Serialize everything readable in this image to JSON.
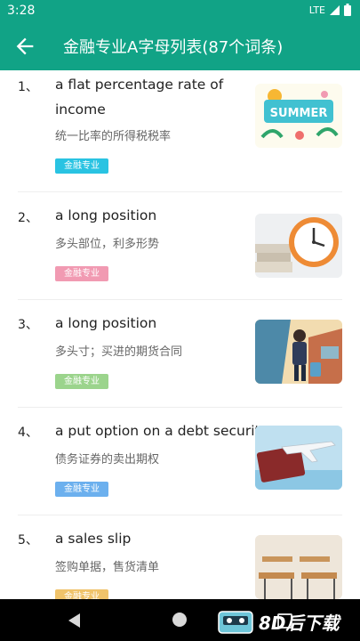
{
  "status": {
    "time": "3:28",
    "network": "LTE"
  },
  "header": {
    "title": "金融专业A字母列表(87个词条)"
  },
  "items": [
    {
      "num": "1、",
      "term": "a flat percentage rate of income",
      "meaning": "统一比率的所得税税率",
      "tag": "金融专业",
      "tag_color": "#29c3e2",
      "thumb": "summer-illustration"
    },
    {
      "num": "2、",
      "term": "a long position",
      "meaning": "多头部位，利多形势",
      "tag": "金融专业",
      "tag_color": "#f19ab2",
      "thumb": "clock-and-books"
    },
    {
      "num": "3、",
      "term": "a long position",
      "meaning": "多头寸；买进的期货合同",
      "tag": "金融专业",
      "tag_color": "#9bd48c",
      "thumb": "traveler-illustration"
    },
    {
      "num": "4、",
      "term": "a put option on a debt security",
      "meaning": "债务证券的卖出期权",
      "tag": "金融专业",
      "tag_color": "#6cb0ee",
      "thumb": "passport-airplane"
    },
    {
      "num": "5、",
      "term": "a sales slip",
      "meaning": "签购单据，售货清单",
      "tag": "金融专业",
      "tag_color": "#f0c36a",
      "thumb": "classroom-desks"
    }
  ],
  "watermark": {
    "text": "8D后下载"
  }
}
